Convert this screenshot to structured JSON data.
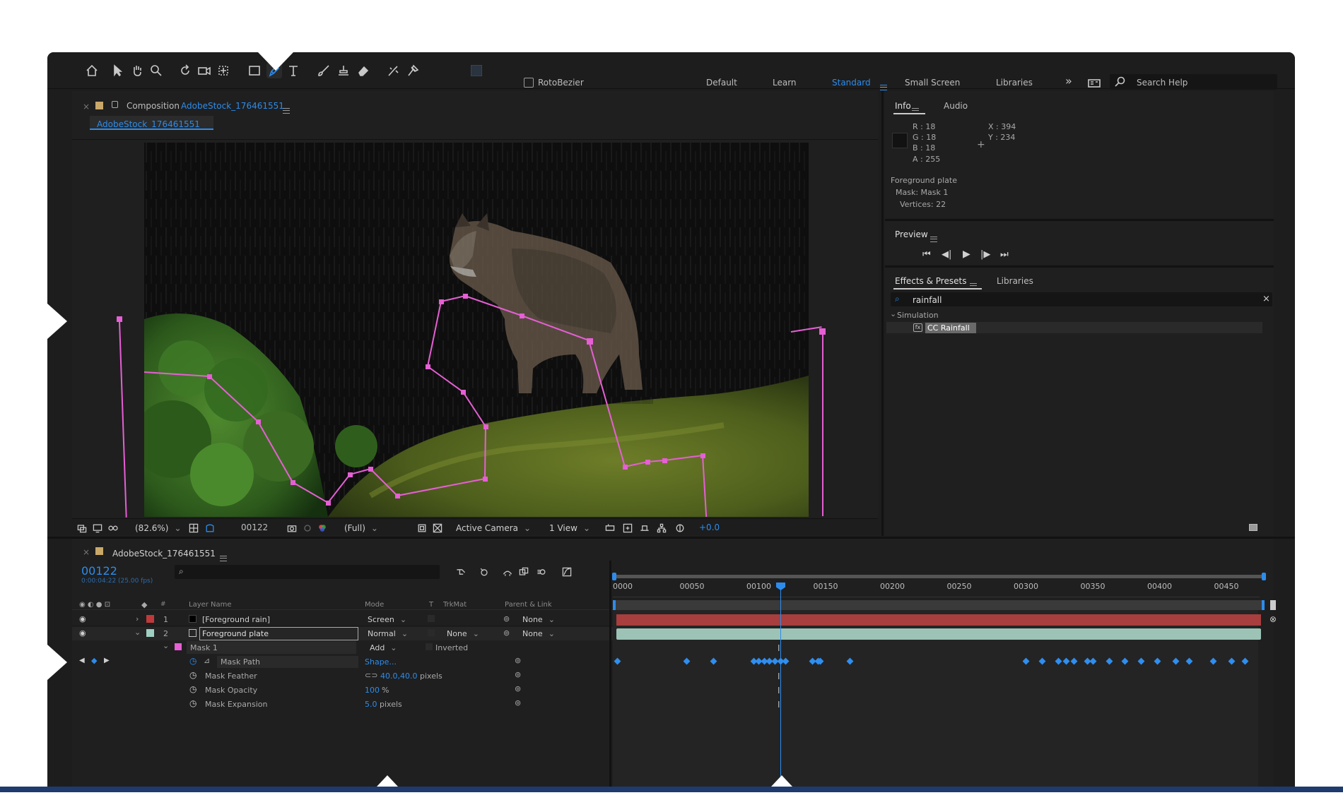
{
  "toolbar": {
    "rotobezier_label": "RotoBezier",
    "workspaces": [
      "Default",
      "Learn",
      "Standard",
      "Small Screen",
      "Libraries"
    ],
    "active_workspace": "Standard",
    "search_placeholder": "Search Help"
  },
  "composition_panel": {
    "header_prefix": "Composition",
    "comp_name": "AdobeStock_176461551",
    "tab_label": "AdobeStock_176461551",
    "footer": {
      "zoom": "(82.6%)",
      "timecode": "00122",
      "resolution": "(Full)",
      "camera": "Active Camera",
      "views": "1 View",
      "exposure": "+0.0"
    }
  },
  "info_panel": {
    "tabs": [
      "Info",
      "Audio"
    ],
    "r": "R : 18",
    "g": "G : 18",
    "b": "B : 18",
    "a": "A : 255",
    "x": "X : 394",
    "y": "Y : 234",
    "line1": "Foreground plate",
    "line2": "Mask: Mask 1",
    "line3": "Vertices: 22"
  },
  "preview_panel": {
    "title": "Preview"
  },
  "effects_panel": {
    "tabs": [
      "Effects & Presets",
      "Libraries"
    ],
    "search_value": "rainfall",
    "category": "Simulation",
    "effect": "CC Rainfall"
  },
  "timeline": {
    "tab_label": "AdobeStock_176461551",
    "current_time": "00122",
    "current_time_sub": "0:00:04:22 (25.00 fps)",
    "columns": {
      "layer_name": "Layer Name",
      "mode": "Mode",
      "t": "T",
      "trkmat": "TrkMat",
      "parent": "Parent & Link"
    },
    "layers": [
      {
        "num": "1",
        "name": "[Foreground rain]",
        "mode": "Screen",
        "trkmat": "",
        "parent": "None",
        "color": "#c0393a"
      },
      {
        "num": "2",
        "name": "Foreground plate",
        "mode": "Normal",
        "trkmat": "None",
        "parent": "None",
        "color": "#9fd0c2"
      }
    ],
    "mask": {
      "name": "Mask 1",
      "mode": "Add",
      "inverted": "Inverted",
      "props": [
        {
          "name": "Mask Path",
          "value": "Shape..."
        },
        {
          "name": "Mask Feather",
          "value": "40.0,40.0",
          "unit": " pixels"
        },
        {
          "name": "Mask Opacity",
          "value": "100",
          "unit": "%"
        },
        {
          "name": "Mask Expansion",
          "value": "5.0",
          "unit": " pixels"
        }
      ]
    },
    "ruler_ticks": [
      "0000",
      "00050",
      "00100",
      "00150",
      "00200",
      "00250",
      "00300",
      "00350",
      "00400",
      "00450"
    ],
    "colors": {
      "playhead": "#2d8ceb",
      "layer1_bar": "#a83e3e",
      "layer2_bar": "#9cc3b6",
      "keyframe": "#2f8ef0"
    }
  }
}
